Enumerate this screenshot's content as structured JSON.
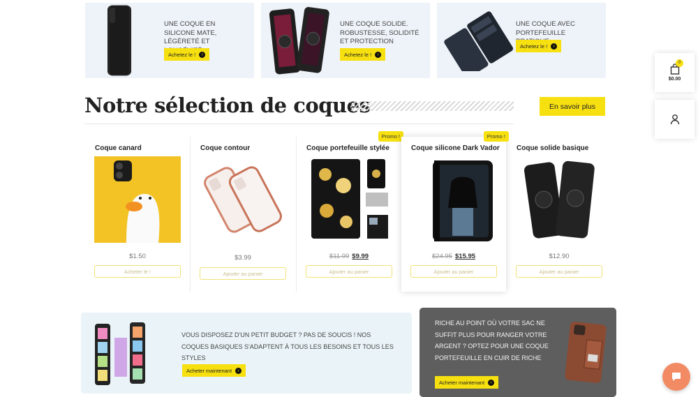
{
  "top_banners": [
    {
      "text": "UNE COQUE EN SILICONE MATE, LÉGÈRETÉ ET LONGÉVITÉ",
      "button": "Achetez le !"
    },
    {
      "text": "UNE COQUE SOLIDE. ROBUSTESSE, SOLIDITÉ ET PROTECTION",
      "button": "Achetez le !"
    },
    {
      "text": "UNE COQUE AVEC PORTEFEUILLE PRATIQUE",
      "button": "Achetez le !"
    }
  ],
  "section": {
    "title": "Notre sélection de coques",
    "more_button": "En savoir plus"
  },
  "cart": {
    "count": "0",
    "total": "$0.00",
    "icon": "shopping-bag-icon"
  },
  "account": {
    "icon": "user-icon"
  },
  "products": [
    {
      "name": "Coque canard",
      "price": "$1.50",
      "old_price": "",
      "promo": "",
      "button": "Acheter le !"
    },
    {
      "name": "Coque contour",
      "price": "$3.99",
      "old_price": "",
      "promo": "",
      "button": "Ajouter au panier"
    },
    {
      "name": "Coque portefeuille stylée",
      "price": "$9.99",
      "old_price": "$11.99",
      "promo": "Promo !",
      "button": "Ajouter au panier"
    },
    {
      "name": "Coque silicone Dark Vador",
      "price": "$15.95",
      "old_price": "$24.95",
      "promo": "Promo !",
      "button": "Ajouter au panier"
    },
    {
      "name": "Coque solide basique",
      "price": "$12.90",
      "old_price": "",
      "promo": "",
      "button": "Ajouter au panier"
    }
  ],
  "bottom_banners": [
    {
      "text": "VOUS DISPOSEZ D'UN PETIT BUDGET ? PAS DE SOUCIS ! NOS COQUES BASIQUES S'ADAPTENT À TOUS LES BESOINS ET TOUS LES STYLES",
      "button": "Acheter maintenant"
    },
    {
      "text": "RICHE AU POINT OÙ VOTRE SAC NE SUFFIT PLUS POUR RANGER VOTRE ARGENT ? OPTEZ POUR UNE COQUE PORTEFEUILLE EN CUIR DE RICHE",
      "button": "Acheter maintenant"
    }
  ],
  "colors": {
    "accent": "#f7e010",
    "banner_bg": "#eef3f9",
    "dark_banner": "#5e5e5e",
    "chat": "#f28a63"
  }
}
